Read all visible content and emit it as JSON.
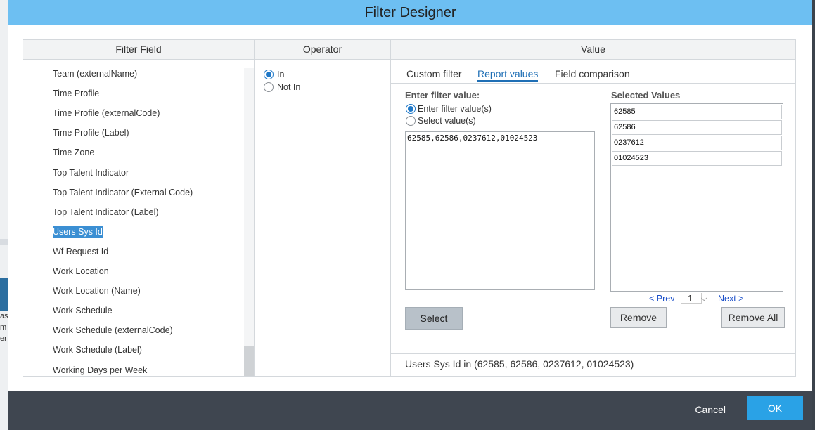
{
  "dialog": {
    "title": "Filter Designer"
  },
  "background": {
    "fragments": [
      "as",
      "m",
      "er"
    ]
  },
  "filter_field": {
    "header": "Filter Field",
    "items": [
      {
        "label": "Team (externalName)",
        "selected": false
      },
      {
        "label": "Time Profile",
        "selected": false
      },
      {
        "label": "Time Profile (externalCode)",
        "selected": false
      },
      {
        "label": "Time Profile (Label)",
        "selected": false
      },
      {
        "label": "Time Zone",
        "selected": false
      },
      {
        "label": "Top Talent Indicator",
        "selected": false
      },
      {
        "label": "Top Talent Indicator (External Code)",
        "selected": false
      },
      {
        "label": "Top Talent Indicator (Label)",
        "selected": false
      },
      {
        "label": "Users Sys Id",
        "selected": true
      },
      {
        "label": "Wf Request Id",
        "selected": false
      },
      {
        "label": "Work Location",
        "selected": false
      },
      {
        "label": "Work Location (Name)",
        "selected": false
      },
      {
        "label": "Work Schedule",
        "selected": false
      },
      {
        "label": "Work Schedule (externalCode)",
        "selected": false
      },
      {
        "label": "Work Schedule (Label)",
        "selected": false
      },
      {
        "label": "Working Days per Week",
        "selected": false
      }
    ]
  },
  "operator": {
    "header": "Operator",
    "options": [
      {
        "label": "In",
        "checked": true
      },
      {
        "label": "Not In",
        "checked": false
      }
    ]
  },
  "value": {
    "header": "Value",
    "tabs": [
      {
        "label": "Custom filter",
        "active": false
      },
      {
        "label": "Report values",
        "active": true
      },
      {
        "label": "Field comparison",
        "active": false
      }
    ],
    "enter_label": "Enter filter value:",
    "mode_options": [
      {
        "label": "Enter filter value(s)",
        "checked": true
      },
      {
        "label": "Select value(s)",
        "checked": false
      }
    ],
    "input_text": "62585,62586,0237612,01024523",
    "select_button": "Select",
    "selected_values_label": "Selected Values",
    "selected_values": [
      "62585",
      "62586",
      "0237612",
      "01024523"
    ],
    "pager": {
      "prev": "< Prev",
      "page": "1",
      "next": "Next >"
    },
    "remove_button": "Remove",
    "remove_all_button": "Remove All",
    "summary": "Users Sys Id in (62585, 62586, 0237612, 01024523)"
  },
  "footer": {
    "cancel": "Cancel",
    "ok": "OK"
  }
}
